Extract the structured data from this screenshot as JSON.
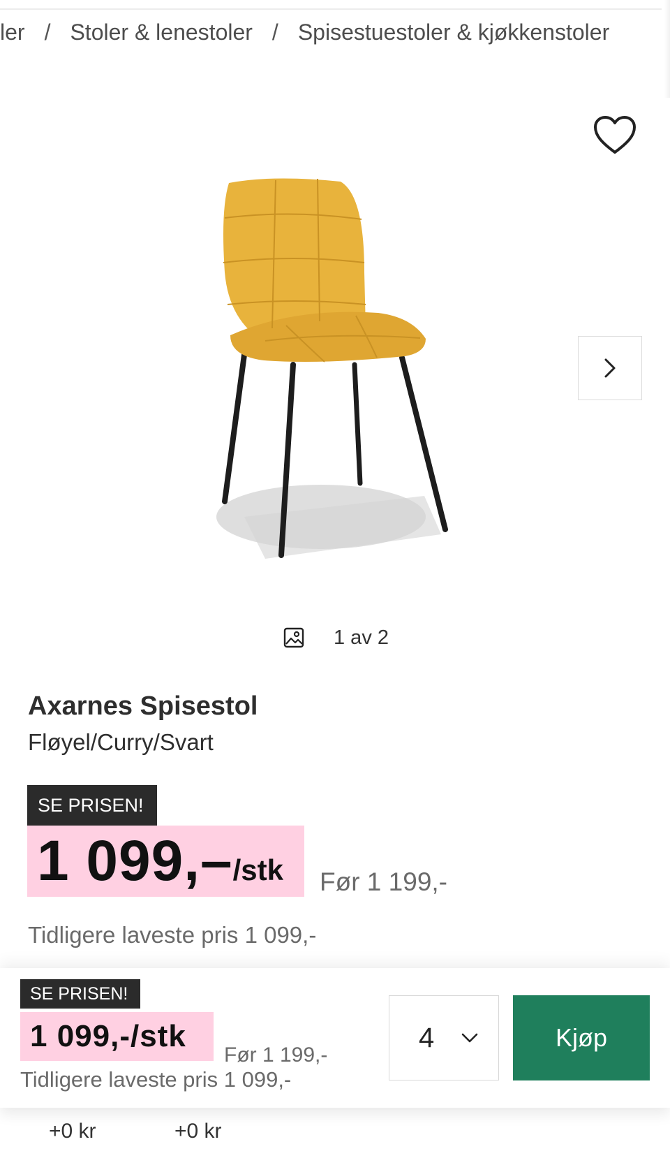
{
  "breadcrumb": {
    "items": [
      "ler",
      "Stoler & lenestoler",
      "Spisestuestoler & kjøkkenstoler"
    ],
    "separator": "/"
  },
  "icons": {
    "favorite": "heart-icon",
    "next": "chevron-right-icon",
    "gallery": "image-icon",
    "qty_dropdown": "chevron-down-icon"
  },
  "gallery": {
    "counter": "1 av 2"
  },
  "product": {
    "name": "Axarnes Spisestol",
    "variant": "Fløyel/Curry/Svart",
    "badge": "SE PRISEN!",
    "price": "1 099,–",
    "unit": "/stk",
    "before": "Før 1 199,-",
    "lowest": "Tidligere laveste pris 1 099,-"
  },
  "sticky_bar": {
    "badge": "SE PRISEN!",
    "price": "1 099,-/stk",
    "before": "Før 1 199,-",
    "lowest": "Tidligere laveste pris 1 099,-",
    "quantity": "4",
    "buy_label": "Kjøp"
  },
  "addons": [
    "+0 kr",
    "+0 kr"
  ],
  "colors": {
    "price_highlight": "#ffd0e2",
    "badge_bg": "#2b2b2b",
    "buy_button": "#1f7f5c",
    "chair_fabric": "#e8b33c"
  }
}
